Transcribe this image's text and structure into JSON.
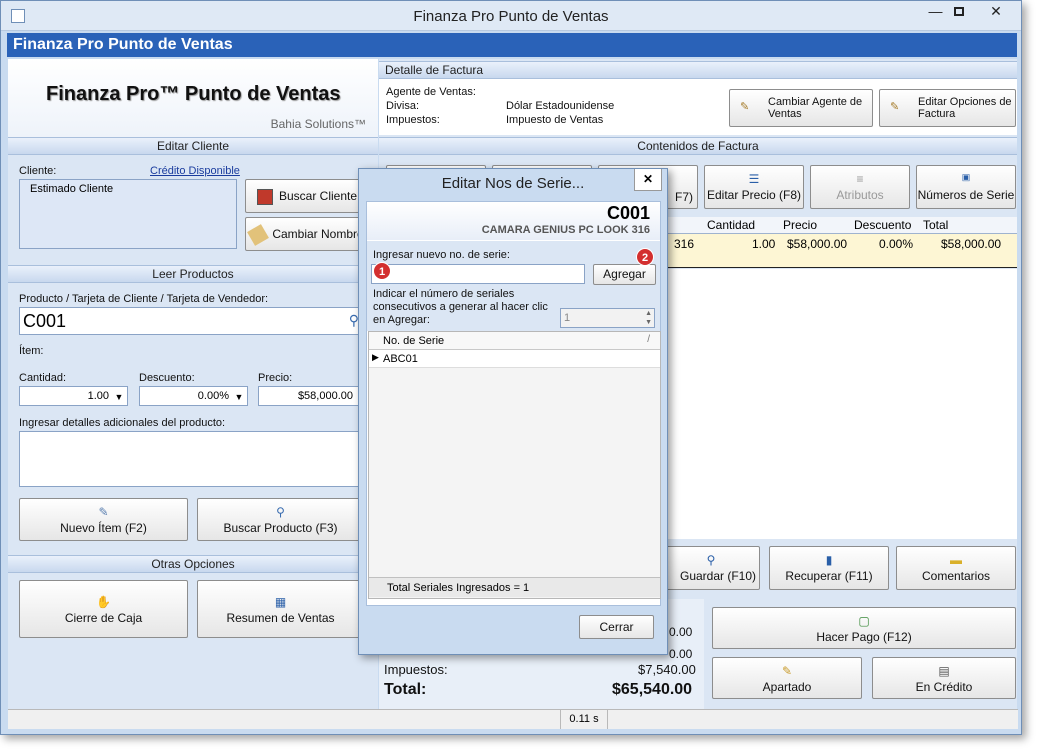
{
  "window": {
    "title": "Finanza Pro Punto de Ventas"
  },
  "app_header": "Finanza Pro Punto de Ventas",
  "brand": {
    "title": "Finanza Pro™ Punto de Ventas",
    "subtitle": "Bahia Solutions™"
  },
  "editar_cliente": {
    "heading": "Editar Cliente",
    "cliente_label": "Cliente:",
    "credito_link": "Crédito Disponible",
    "cliente_value": "Estimado Cliente",
    "buscar_btn": "Buscar Cliente",
    "cambiar_btn": "Cambiar Nombre"
  },
  "leer_productos": {
    "heading": "Leer Productos",
    "producto_label": "Producto / Tarjeta de Cliente / Tarjeta de Vendedor:",
    "producto_value": "C001",
    "item_label": "Ítem:",
    "cantidad_label": "Cantidad:",
    "cantidad_value": "1.00",
    "descuento_label": "Descuento:",
    "descuento_value": "0.00%",
    "precio_label": "Precio:",
    "precio_value": "$58,000.00",
    "detalles_label": "Ingresar detalles adicionales del producto:",
    "nuevo_btn": "Nuevo Ítem (F2)",
    "buscar_prod_btn": "Buscar Producto (F3)"
  },
  "otras_opciones": {
    "heading": "Otras Opciones",
    "cierre_btn": "Cierre de Caja",
    "resumen_btn": "Resumen de Ventas"
  },
  "detalle_factura": {
    "heading": "Detalle de Factura",
    "agente_label": "Agente de Ventas:",
    "divisa_label": "Divisa:",
    "divisa_value": "Dólar Estadounidense",
    "impuestos_label": "Impuestos:",
    "impuestos_value": "Impuesto de Ventas",
    "cambiar_agente_btn": "Cambiar Agente de Ventas",
    "editar_opciones_btn": "Editar Opciones de Factura"
  },
  "contenidos": {
    "heading": "Contenidos de Factura",
    "f7_fragment": "F7)",
    "editar_precio_btn": "Editar Precio (F8)",
    "atributos_btn": "Atributos",
    "numeros_serie_btn": "Números de Serie",
    "columns": [
      "Cantidad",
      "Precio",
      "Descuento",
      "Total"
    ],
    "row": {
      "desc_fragment": "316",
      "cantidad": "1.00",
      "precio": "$58,000.00",
      "descuento": "0.00%",
      "total": "$58,000.00"
    }
  },
  "actions": {
    "guardar_fragment": "Guardar (F10)",
    "recuperar_btn": "Recuperar (F11)",
    "comentarios_btn": "Comentarios",
    "hacer_pago_btn": "Hacer Pago (F12)",
    "apartado_btn": "Apartado",
    "en_credito_btn": "En Crédito"
  },
  "totals": {
    "frag1": "0.00",
    "frag2": "0.00",
    "impuestos_label": "Impuestos:",
    "impuestos_value": "$7,540.00",
    "total_label": "Total:",
    "total_value": "$65,540.00"
  },
  "status": {
    "time": "0.11 s"
  },
  "dialog": {
    "title": "Editar Nos de Serie...",
    "code": "C001",
    "product": "CAMARA GENIUS PC LOOK 316",
    "input_label": "Ingresar nuevo no. de serie:",
    "input_value": "",
    "agregar_btn": "Agregar",
    "consec_label": "Indicar el número de seriales consecutivos a generar al hacer clic en Agregar:",
    "consec_value": "1",
    "grid_header": "No. de Serie",
    "serials": [
      "ABC01"
    ],
    "total_label": "Total Seriales Ingresados = 1",
    "cerrar_btn": "Cerrar",
    "badge1": "1",
    "badge2": "2"
  },
  "colors": {
    "header_blue": "#2a62b8",
    "panel": "#dbe6f4",
    "row_highlight": "#fdf6d4",
    "badge_red": "#d32f2f"
  }
}
